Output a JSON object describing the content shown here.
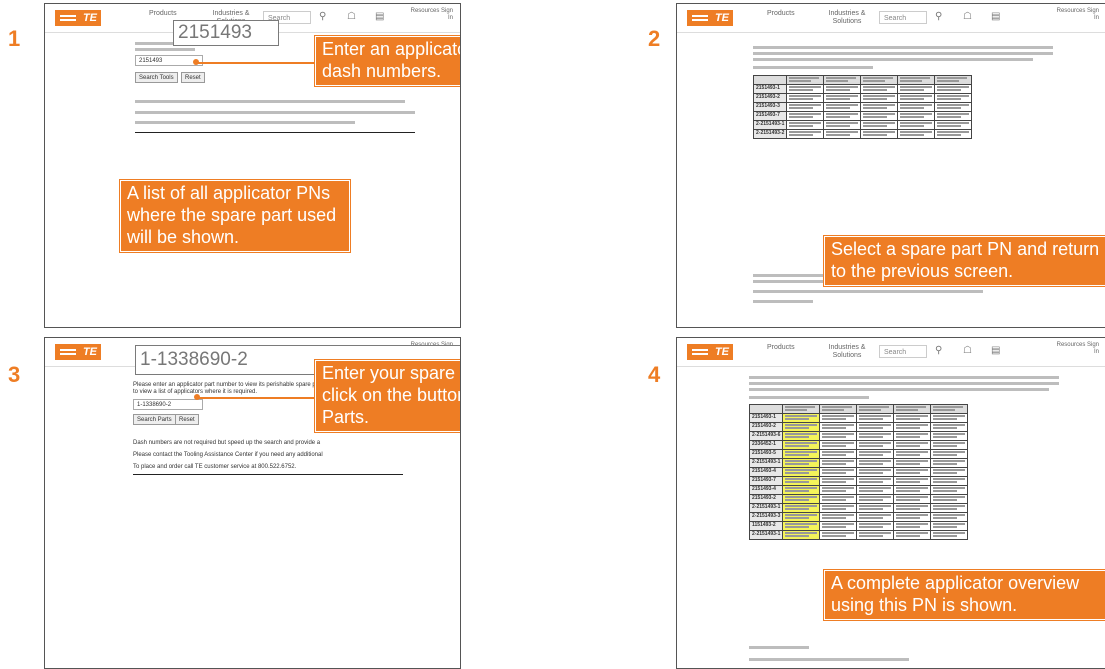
{
  "colors": {
    "accent": "#EE7D24",
    "panel_border": "#555555",
    "highlight": "#F4F45A"
  },
  "site": {
    "logo": "TE",
    "nav_products": "Products",
    "nav_industries": "Industries & Solutions",
    "search_placeholder": "Search",
    "account": "Resources Sign In"
  },
  "steps": [
    {
      "number": "1",
      "pn_box": "2151493",
      "callout": "Enter an applicator PN without dash numbers.",
      "callout2": "A list of all applicator PNs where the spare part used will be shown."
    },
    {
      "number": "2",
      "callout": "Select a spare part PN and return to the previous screen."
    },
    {
      "number": "3",
      "pn_box": "1-1338690-2",
      "callout": "Enter your spare part PN and click on the button Search Parts."
    },
    {
      "number": "4",
      "callout": "A complete applicator overview using this PN is shown."
    }
  ],
  "forms": {
    "p1_input": "2151493",
    "p1_search": "Search Tools",
    "p1_reset": "Reset",
    "p3_input": "1-1338690-2",
    "p3_search": "Search Parts",
    "p3_reset": "Reset",
    "p3_line1": "Please enter an applicator part number to view its perishable spare parts",
    "p3_line2": "to view a list of applicators where it is required.",
    "p3_line3": "Dash numbers are not required but speed up the search and provide a",
    "p3_line4": "Please contact the Tooling Assistance Center if you need any additional",
    "p3_line5": "To place and order call TE customer service at 800.522.6752."
  },
  "tables": {
    "p2_rows": [
      "2151493-1",
      "2151493-2",
      "2151493-3",
      "2151493-7",
      "2-2151493-1",
      "2-2151493-2"
    ],
    "p4_rows": [
      "2151493-1",
      "2151493-2",
      "2-2151493-6",
      "2336452-1",
      "2151493-5",
      "2-2151493-1",
      "2151493-4",
      "2151493-7",
      "2151493-4",
      "2151493-2",
      "2-2151493-1",
      "2-2151493-3",
      "1151493-2",
      "2-2151493-1"
    ]
  }
}
